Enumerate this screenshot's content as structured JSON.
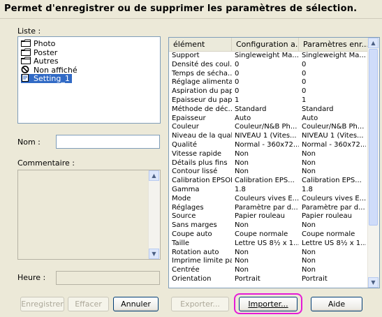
{
  "window": {
    "title": "Permet d'enregistrer ou de supprimer les paramètres de sélection."
  },
  "list": {
    "label": "Liste :",
    "items": [
      {
        "label": "Photo",
        "icon": "folder-icon"
      },
      {
        "label": "Poster",
        "icon": "folder-icon"
      },
      {
        "label": "Autres",
        "icon": "folder-icon"
      },
      {
        "label": "Non affiché",
        "icon": "no-entry-icon"
      },
      {
        "label": "Setting_1",
        "icon": "settings-file-icon",
        "selected": true
      }
    ]
  },
  "form": {
    "name_label": "Nom :",
    "name_value": "",
    "comment_label": "Commentaire :",
    "comment_value": "",
    "time_label": "Heure :",
    "time_value": ""
  },
  "table": {
    "columns": [
      "élément",
      "Configuration a...",
      "Paramètres enr..."
    ],
    "rows": [
      [
        "Support",
        "Singleweight Ma...",
        "Singleweight Ma..."
      ],
      [
        "Densité des coul...",
        "0",
        "0"
      ],
      [
        "Temps de sécha...",
        "0",
        "0"
      ],
      [
        "Réglage alimenta...",
        "0",
        "0"
      ],
      [
        "Aspiration du pap...",
        "0",
        "0"
      ],
      [
        "Epaisseur du pap...",
        "1",
        "1"
      ],
      [
        "Méthode de déc...",
        "Standard",
        "Standard"
      ],
      [
        "Epaisseur",
        "Auto",
        "Auto"
      ],
      [
        "Couleur",
        "Couleur/N&B Ph...",
        "Couleur/N&B Ph..."
      ],
      [
        "Niveau de la qual...",
        "NIVEAU 1 (Vites...",
        "NIVEAU 1 (Vites..."
      ],
      [
        "Qualité",
        "Normal - 360x72...",
        "Normal - 360x72..."
      ],
      [
        "Vitesse rapide",
        "Non",
        "Non"
      ],
      [
        "Détails plus fins",
        "Non",
        "Non"
      ],
      [
        "Contour lissé",
        "Non",
        "Non"
      ],
      [
        "Calibration EPSON",
        "Calibration EPS...",
        "Calibration EPS..."
      ],
      [
        "Gamma",
        "1.8",
        "1.8"
      ],
      [
        "Mode",
        "Couleurs vives E...",
        "Couleurs vives E..."
      ],
      [
        "Réglages",
        "Paramètre par d...",
        "Paramètre par d..."
      ],
      [
        "Source",
        "Papier rouleau",
        "Papier rouleau"
      ],
      [
        "Sans marges",
        "Non",
        "Non"
      ],
      [
        "Coupe auto",
        "Coupe normale",
        "Coupe normale"
      ],
      [
        "Taille",
        "Lettre US 8½ x 1...",
        "Lettre US 8½ x 1..."
      ],
      [
        "Rotation auto",
        "Non",
        "Non"
      ],
      [
        "Imprime limite page",
        "Non",
        "Non"
      ],
      [
        "Centrée",
        "Non",
        "Non"
      ],
      [
        "Orientation",
        "Portrait",
        "Portrait"
      ]
    ]
  },
  "buttons": {
    "save": "Enregistrer",
    "delete": "Effacer",
    "cancel": "Annuler",
    "export": "Exporter...",
    "import": "Importer...",
    "help": "Aide"
  },
  "colors": {
    "selection": "#316ac5",
    "highlight_ring": "#e51bd6",
    "dialog_bg": "#ece9d8"
  }
}
